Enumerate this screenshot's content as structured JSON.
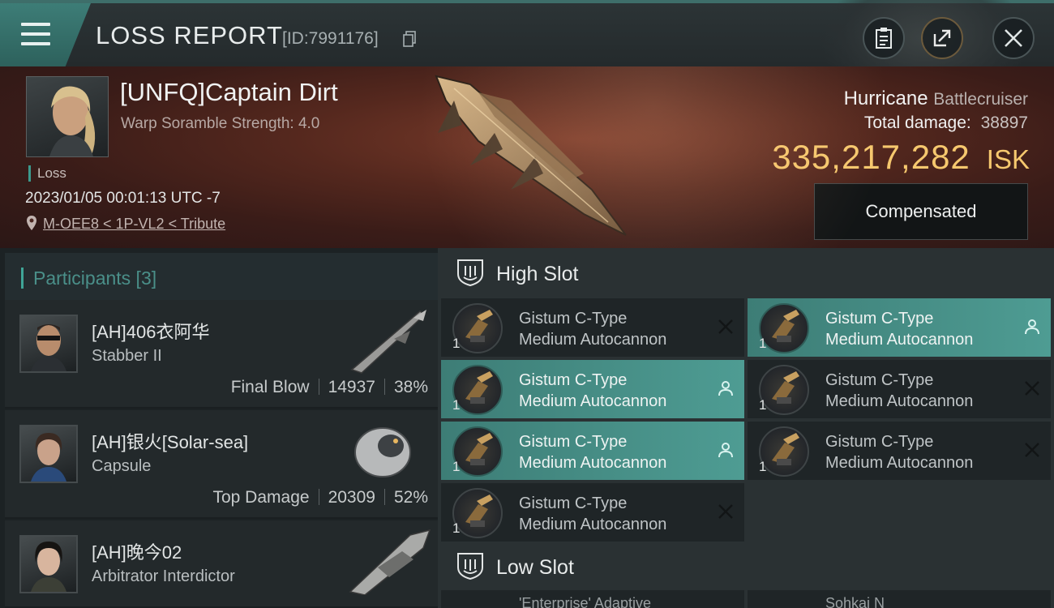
{
  "header": {
    "title": "LOSS REPORT",
    "id_label": "[ID:7991176]"
  },
  "victim": {
    "name": "[UNFQ]Captain Dirt",
    "scramble": "Warp Soramble Strength: 4.0",
    "status": "Loss",
    "datetime": "2023/01/05 00:01:13 UTC -7",
    "location": "M-OEE8 < 1P-VL2 < Tribute",
    "ship_name": "Hurricane",
    "ship_class": "Battlecruiser",
    "total_damage_label": "Total damage:",
    "total_damage": "38897",
    "isk_value": "335,217,282",
    "isk_unit": "ISK",
    "compensated_label": "Compensated"
  },
  "participants": {
    "title": "Participants [3]",
    "items": [
      {
        "name": "[AH]406衣阿华",
        "ship": "Stabber II",
        "tag": "Final Blow",
        "damage": "14937",
        "pct": "38%"
      },
      {
        "name": "[AH]银火[Solar-sea]",
        "ship": "Capsule",
        "tag": "Top Damage",
        "damage": "20309",
        "pct": "52%"
      },
      {
        "name": "[AH]晚今02",
        "ship": "Arbitrator Interdictor",
        "tag": "",
        "damage": "",
        "pct": ""
      }
    ]
  },
  "slots": {
    "high_label": "High Slot",
    "low_label": "Low Slot",
    "high_modules": [
      {
        "line1": "Gistum C-Type",
        "line2": "Medium Autocannon",
        "qty": "1",
        "state": "destroyed",
        "active": false
      },
      {
        "line1": "Gistum C-Type",
        "line2": "Medium Autocannon",
        "qty": "1",
        "state": "dropped",
        "active": true
      },
      {
        "line1": "Gistum C-Type",
        "line2": "Medium Autocannon",
        "qty": "1",
        "state": "dropped",
        "active": true
      },
      {
        "line1": "Gistum C-Type",
        "line2": "Medium Autocannon",
        "qty": "1",
        "state": "destroyed",
        "active": false
      },
      {
        "line1": "Gistum C-Type",
        "line2": "Medium Autocannon",
        "qty": "1",
        "state": "dropped",
        "active": true
      },
      {
        "line1": "Gistum C-Type",
        "line2": "Medium Autocannon",
        "qty": "1",
        "state": "destroyed",
        "active": false
      },
      {
        "line1": "Gistum C-Type",
        "line2": "Medium Autocannon",
        "qty": "1",
        "state": "destroyed",
        "active": false
      }
    ],
    "low_partial": [
      "'Enterprise' Adaptive",
      "Sohkai N"
    ]
  },
  "icons": {
    "menu": "menu-icon",
    "copy": "copy-icon",
    "report": "clipboard-icon",
    "share": "share-icon",
    "close": "close-icon",
    "location": "map-pin-icon",
    "slot": "shield-slot-icon",
    "destroyed": "x-mark-icon",
    "dropped": "person-icon"
  },
  "colors": {
    "accent_teal": "#3fa597",
    "isk_gold": "#f6c86e",
    "active_module": "#4e9c93"
  }
}
